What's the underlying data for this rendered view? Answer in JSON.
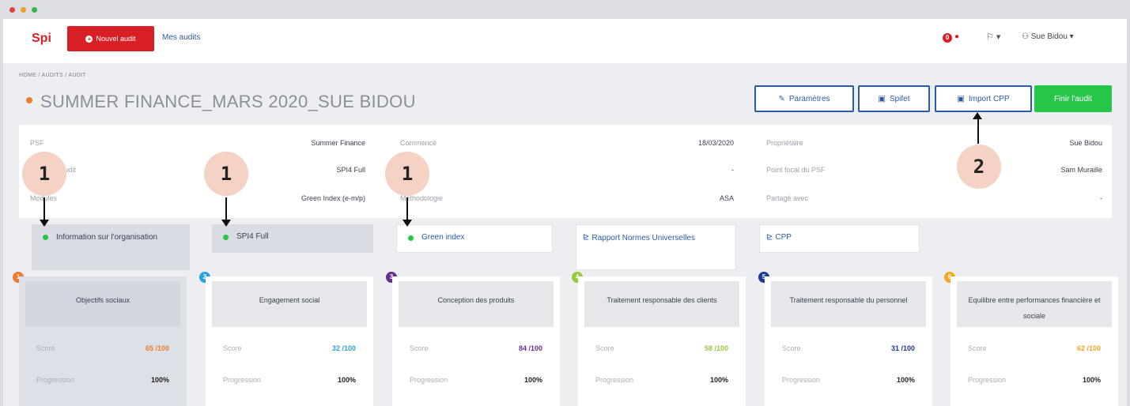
{
  "nav": {
    "brand": "Spi",
    "new_audit": "Nouvel audit",
    "my_audits": "Mes audits",
    "notification_count": "0",
    "user": "Sue Bidou ▾",
    "flag_caret": "▾"
  },
  "breadcrumb": "HOME / AUDITS / AUDIT",
  "title": "SUMMER FINANCE_MARS 2020_SUE BIDOU",
  "toolbar": {
    "parametres": "Paramètres",
    "spifet": "Spifet",
    "import_cpp": "Import CPP",
    "finir": "Finir l'audit"
  },
  "info": {
    "col1": [
      {
        "label": "PSF",
        "value": "Summer Finance"
      },
      {
        "label": "Type de l'audit",
        "value": "SPI4 Full"
      },
      {
        "label": "Modules",
        "value": "Green Index (e-m/p)"
      }
    ],
    "col2": [
      {
        "label": "Commencé",
        "value": "18/03/2020"
      },
      {
        "label": "",
        "value": "-"
      },
      {
        "label": "Méthodologie",
        "value": "ASA"
      }
    ],
    "col3": [
      {
        "label": "Propriétaire",
        "value": "Sue Bidou"
      },
      {
        "label": "Point focal du PSF",
        "value": "Sam Muraille"
      },
      {
        "label": "Partagé avec",
        "value": "-"
      }
    ]
  },
  "modules": [
    {
      "label": "Information sur l'organisation"
    },
    {
      "label": "SPI4 Full"
    },
    {
      "label": "Green index"
    },
    {
      "label": "Rapport Normes Universelles"
    },
    {
      "label": "CPP"
    }
  ],
  "dimensions": [
    {
      "num": "1",
      "title": "Objectifs sociaux",
      "score": "65 /100",
      "progression": "100%",
      "color": "#f07b2a"
    },
    {
      "num": "2",
      "title": "Engagement social",
      "score": "32 /100",
      "progression": "100%",
      "color": "#29a3dc"
    },
    {
      "num": "3",
      "title": "Conception des produits",
      "score": "84 /100",
      "progression": "100%",
      "color": "#6b2c91"
    },
    {
      "num": "4",
      "title": "Traitement responsable des clients",
      "score": "58 /100",
      "progression": "100%",
      "color": "#97c93d"
    },
    {
      "num": "5",
      "title": "Traitement responsable du personnel",
      "score": "31 /100",
      "progression": "100%",
      "color": "#1f3a8f"
    },
    {
      "num": "6",
      "title": "Equilibre entre performances financière et sociale",
      "score": "62 /100",
      "progression": "100%",
      "color": "#f5a623"
    }
  ],
  "labels": {
    "score": "Score",
    "progression": "Progression"
  },
  "callouts": [
    "1",
    "1",
    "1",
    "2"
  ]
}
